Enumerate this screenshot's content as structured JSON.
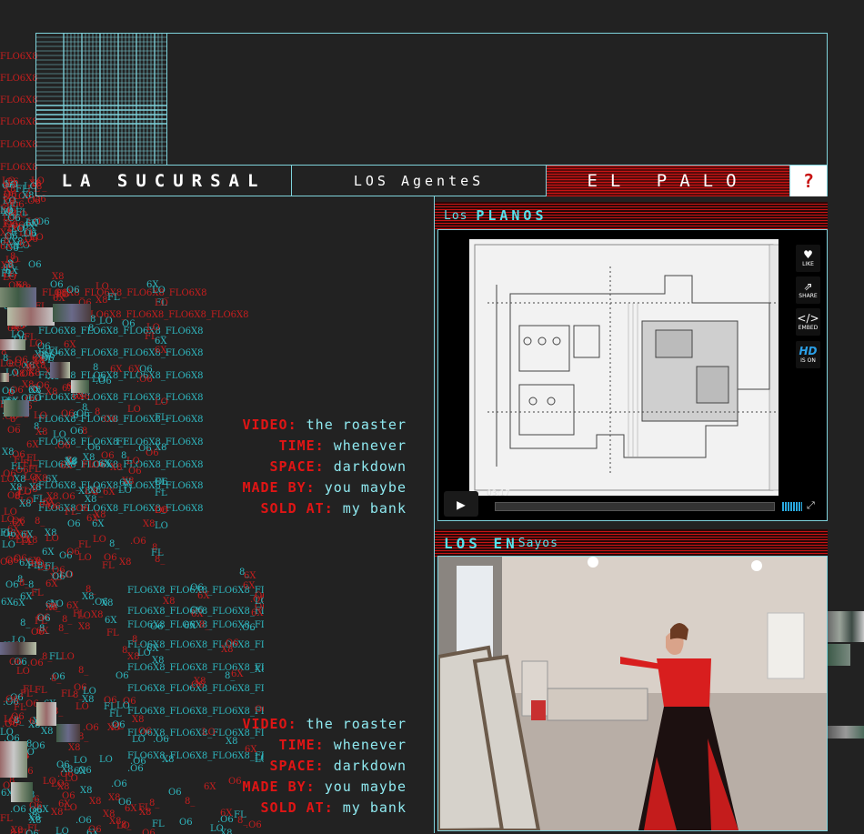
{
  "nav": {
    "sucursal_label": "LA SUCURSAL",
    "agentes_label": "LOS AgenteS",
    "palo_label": "EL PALO",
    "help_label": "?"
  },
  "noise_text": "FLO6X8_FLO6X8",
  "sections": {
    "planos_prefix": "Los",
    "planos_title": "PLANOS",
    "ensayos_title": "LOS EN",
    "ensayos_suffix": "Sayos"
  },
  "player": {
    "time": "03:17",
    "progress": 0.0,
    "buttons": [
      {
        "name": "like",
        "label": "LIKE",
        "icon": "heart-icon"
      },
      {
        "name": "share",
        "label": "SHARE",
        "icon": "share-icon"
      },
      {
        "name": "embed",
        "label": "EMBED",
        "icon": "embed-icon"
      },
      {
        "name": "hd",
        "label": "IS ON",
        "badge": "HD",
        "icon": "hd-icon"
      }
    ]
  },
  "credits": [
    {
      "video_key": "VIDEO:",
      "video_val": "the roaster",
      "time_key": "TIME:",
      "time_val": "whenever",
      "space_key": "SPACE:",
      "space_val": "darkdown",
      "made_key": "MADE BY:",
      "made_val": "you maybe",
      "sold_key": "SOLD AT:",
      "sold_val": "my bank"
    },
    {
      "video_key": "VIDEO:",
      "video_val": "the roaster",
      "time_key": "TIME:",
      "time_val": "whenever",
      "space_key": "SPACE:",
      "space_val": "darkdown",
      "made_key": "MADE BY:",
      "made_val": "you maybe",
      "sold_key": "SOLD AT:",
      "sold_val": "my bank"
    }
  ],
  "colors": {
    "accent_red": "#c81414",
    "accent_cyan": "#7fd3dc",
    "background": "#222222"
  }
}
